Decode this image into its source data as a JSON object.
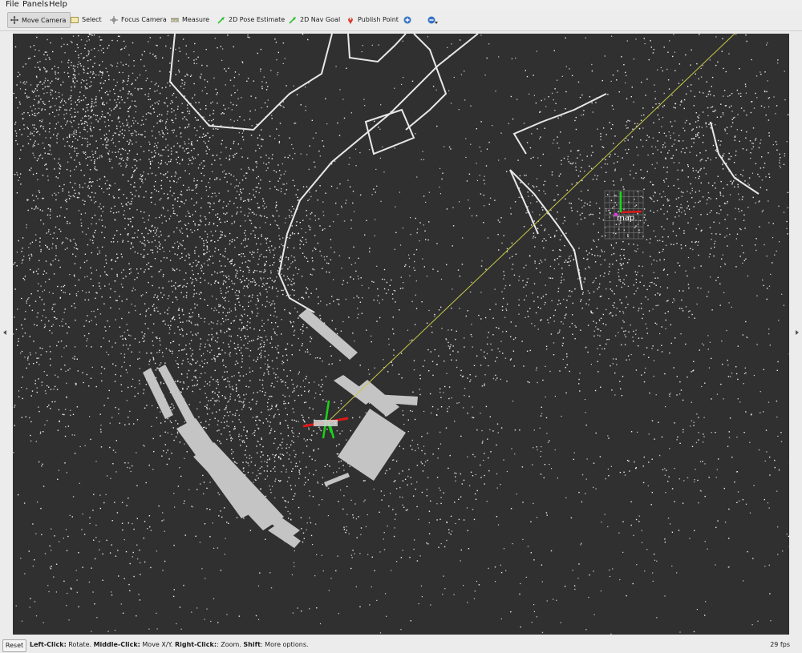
{
  "menu": [
    "File",
    "Panels",
    "Help"
  ],
  "toolbar": {
    "move_camera": "Move Camera",
    "select": "Select",
    "focus_camera": "Focus Camera",
    "measure": "Measure",
    "pose_estimate": "2D Pose Estimate",
    "nav_goal": "2D Nav Goal",
    "publish_point": "Publish Point"
  },
  "viewport": {
    "frame_label": "map",
    "background_color": "#303030",
    "line_color": "#c8c84a"
  },
  "status": {
    "reset": "Reset",
    "hint_parts": [
      "Left-Click:",
      " Rotate. ",
      "Middle-Click:",
      " Move X/Y. ",
      "Right-Click:",
      ": Zoom. ",
      "Shift",
      ": More options."
    ],
    "fps": "29 fps"
  }
}
